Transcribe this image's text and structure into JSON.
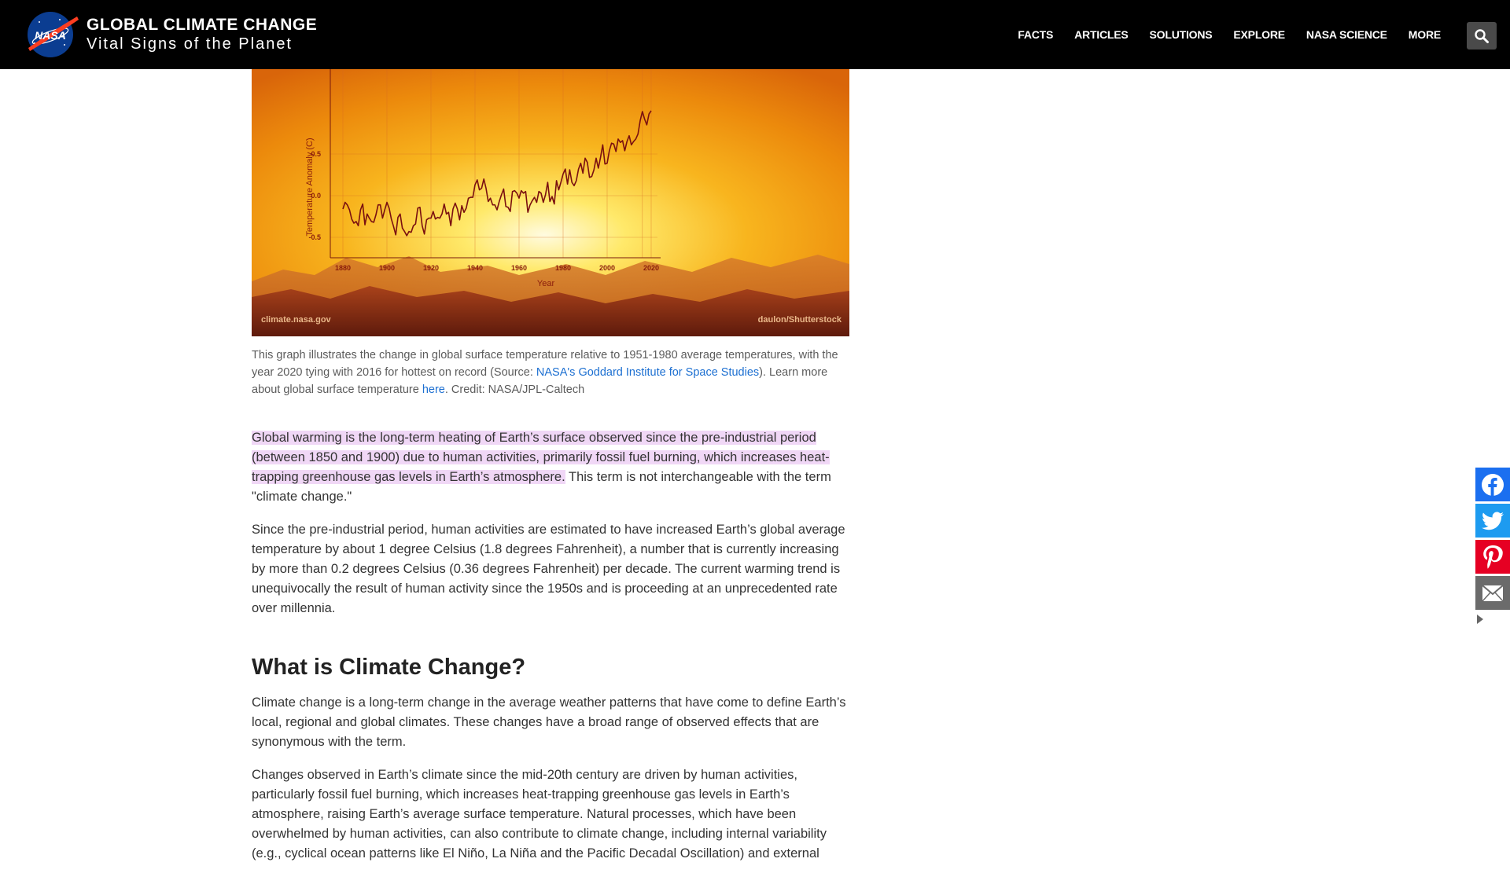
{
  "header": {
    "title": "GLOBAL CLIMATE CHANGE",
    "subtitle": "Vital Signs of the Planet",
    "logo_text": "NASA",
    "nav": [
      {
        "label": "FACTS"
      },
      {
        "label": "ARTICLES"
      },
      {
        "label": "SOLUTIONS"
      },
      {
        "label": "EXPLORE"
      },
      {
        "label": "NASA SCIENCE"
      },
      {
        "label": "MORE"
      }
    ],
    "search_icon": "search-icon"
  },
  "figure": {
    "credit_left": "climate.nasa.gov",
    "credit_right": "daulon/Shutterstock",
    "chart_data": {
      "type": "line",
      "title": "",
      "xlabel": "Year",
      "ylabel": "Temperature Anomaly (C)",
      "xlim": [
        1880,
        2020
      ],
      "ylim": [
        -0.8,
        0.9
      ],
      "x_ticks": [
        "1880",
        "1900",
        "1920",
        "1940",
        "1960",
        "1980",
        "2000",
        "2020"
      ],
      "y_ticks": [
        "0.5",
        "0.0",
        "-0.5"
      ],
      "grid": true,
      "series": [
        {
          "color": "#7a1010",
          "x": [
            1880,
            1881,
            1882,
            1883,
            1884,
            1885,
            1886,
            1887,
            1888,
            1889,
            1890,
            1891,
            1892,
            1893,
            1894,
            1895,
            1896,
            1897,
            1898,
            1899,
            1900,
            1901,
            1902,
            1903,
            1904,
            1905,
            1906,
            1907,
            1908,
            1909,
            1910,
            1911,
            1912,
            1913,
            1914,
            1915,
            1916,
            1917,
            1918,
            1919,
            1920,
            1921,
            1922,
            1923,
            1924,
            1925,
            1926,
            1927,
            1928,
            1929,
            1930,
            1931,
            1932,
            1933,
            1934,
            1935,
            1936,
            1937,
            1938,
            1939,
            1940,
            1941,
            1942,
            1943,
            1944,
            1945,
            1946,
            1947,
            1948,
            1949,
            1950,
            1951,
            1952,
            1953,
            1954,
            1955,
            1956,
            1957,
            1958,
            1959,
            1960,
            1961,
            1962,
            1963,
            1964,
            1965,
            1966,
            1967,
            1968,
            1969,
            1970,
            1971,
            1972,
            1973,
            1974,
            1975,
            1976,
            1977,
            1978,
            1979,
            1980,
            1981,
            1982,
            1983,
            1984,
            1985,
            1986,
            1987,
            1988,
            1989,
            1990,
            1991,
            1992,
            1993,
            1994,
            1995,
            1996,
            1997,
            1998,
            1999,
            2000,
            2001,
            2002,
            2003,
            2004,
            2005,
            2006,
            2007,
            2008,
            2009,
            2010,
            2011,
            2012,
            2013,
            2014,
            2015,
            2016,
            2017,
            2018,
            2019,
            2020
          ],
          "values": [
            -0.16,
            -0.08,
            -0.11,
            -0.17,
            -0.28,
            -0.33,
            -0.31,
            -0.36,
            -0.17,
            -0.1,
            -0.35,
            -0.22,
            -0.27,
            -0.31,
            -0.32,
            -0.23,
            -0.11,
            -0.11,
            -0.27,
            -0.17,
            -0.08,
            -0.15,
            -0.28,
            -0.37,
            -0.47,
            -0.26,
            -0.22,
            -0.39,
            -0.43,
            -0.48,
            -0.43,
            -0.44,
            -0.36,
            -0.34,
            -0.15,
            -0.14,
            -0.36,
            -0.46,
            -0.29,
            -0.27,
            -0.27,
            -0.19,
            -0.28,
            -0.26,
            -0.27,
            -0.22,
            -0.1,
            -0.22,
            -0.2,
            -0.36,
            -0.16,
            -0.09,
            -0.16,
            -0.29,
            -0.12,
            -0.2,
            -0.15,
            -0.03,
            -0.02,
            -0.02,
            0.13,
            0.19,
            0.07,
            0.09,
            0.2,
            0.09,
            -0.07,
            -0.03,
            -0.11,
            -0.11,
            -0.17,
            -0.07,
            0.01,
            0.08,
            -0.13,
            -0.14,
            -0.19,
            0.05,
            0.06,
            0.03,
            -0.03,
            0.06,
            0.03,
            0.05,
            -0.2,
            -0.11,
            -0.06,
            -0.02,
            -0.08,
            0.05,
            0.03,
            -0.08,
            0.01,
            0.16,
            -0.07,
            -0.01,
            -0.1,
            0.18,
            0.07,
            0.16,
            0.26,
            0.32,
            0.14,
            0.31,
            0.16,
            0.12,
            0.18,
            0.32,
            0.39,
            0.27,
            0.45,
            0.4,
            0.22,
            0.23,
            0.31,
            0.45,
            0.33,
            0.46,
            0.61,
            0.38,
            0.39,
            0.54,
            0.63,
            0.62,
            0.53,
            0.68,
            0.64,
            0.66,
            0.54,
            0.65,
            0.72,
            0.61,
            0.65,
            0.68,
            0.74,
            0.9,
            1.01,
            0.92,
            0.85,
            0.98,
            1.02
          ]
        }
      ]
    }
  },
  "caption": {
    "part1": "This graph illustrates the change in global surface temperature relative to 1951-1980 average temperatures, with the year 2020 tying with 2016 for hottest on record (Source: ",
    "link1": "NASA's Goddard Institute for Space Studies",
    "part2": "). Learn more about global surface temperature ",
    "link2": "here",
    "part3": ". Credit: NASA/JPL-Caltech"
  },
  "article": {
    "p1_highlight": "Global warming is the long-term heating of Earth’s surface observed since the pre-industrial period (between 1850 and 1900) due to human activities, primarily fossil fuel burning, which increases heat-trapping greenhouse gas levels in Earth’s atmosphere.",
    "p1_rest": " This term is not interchangeable with the term \"climate change.\"",
    "p2": "Since the pre-industrial period, human activities are estimated to have increased Earth’s global average temperature by about 1 degree Celsius (1.8 degrees Fahrenheit), a number that is currently increasing by more than 0.2 degrees Celsius (0.36 degrees Fahrenheit) per decade. The current warming trend is unequivocally the result of human activity since the 1950s and is proceeding at an unprecedented rate over millennia.",
    "h2": "What is Climate Change?",
    "p3": "Climate change is a long-term change in the average weather patterns that have come to define Earth’s local, regional and global climates. These changes have a broad range of observed effects that are synonymous with the term.",
    "p4": "Changes observed in Earth’s climate since the mid-20th century are driven by human activities, particularly fossil fuel burning, which increases heat-trapping greenhouse gas levels in Earth’s atmosphere, raising Earth’s average surface temperature. Natural processes, which have been overwhelmed by human activities, can also contribute to climate change, including internal variability (e.g., cyclical ocean patterns like El Niño, La Niña and the Pacific Decadal Oscillation) and external"
  },
  "share": {
    "icons": [
      "facebook-icon",
      "twitter-icon",
      "pinterest-icon",
      "email-icon"
    ],
    "colors": {
      "facebook": "#1b6ff0",
      "twitter": "#1d9bf0",
      "pinterest": "#e60023",
      "email": "#6b6b6b"
    }
  }
}
